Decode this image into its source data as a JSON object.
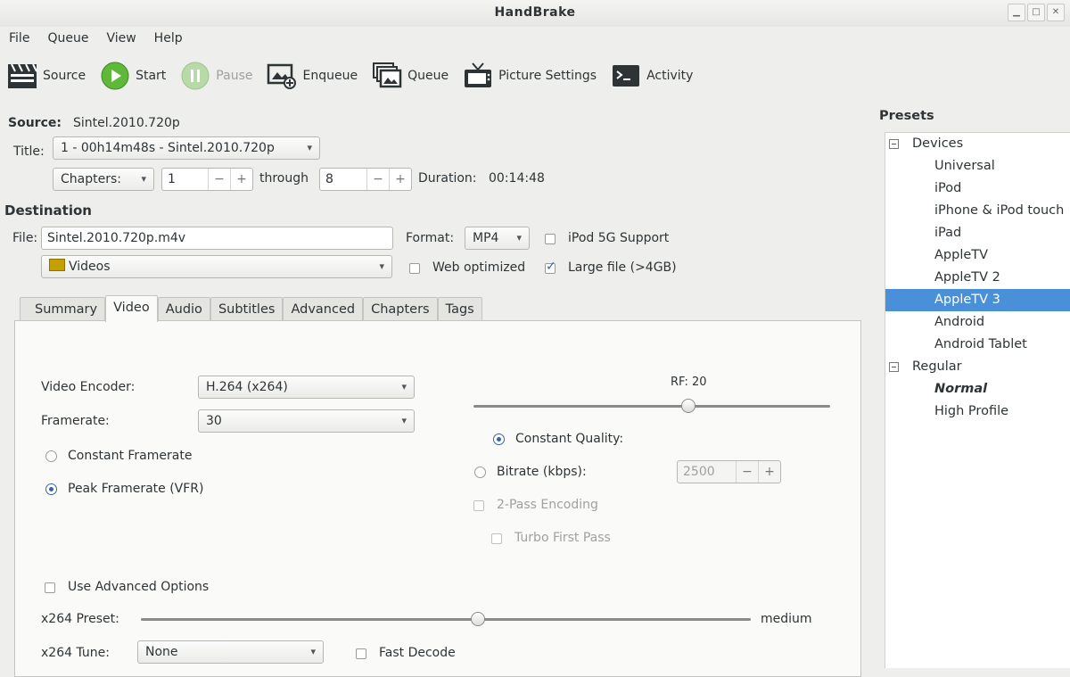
{
  "window": {
    "title": "HandBrake"
  },
  "menu": [
    "File",
    "Queue",
    "View",
    "Help"
  ],
  "toolbar": {
    "source": "Source",
    "start": "Start",
    "pause": "Pause",
    "enqueue": "Enqueue",
    "queue": "Queue",
    "picture_settings": "Picture Settings",
    "activity": "Activity"
  },
  "source": {
    "label": "Source:",
    "value": "Sintel.2010.720p"
  },
  "title_row": {
    "label": "Title:",
    "value": "1 - 00h14m48s - Sintel.2010.720p"
  },
  "chapters": {
    "mode": "Chapters:",
    "start": "1",
    "through_label": "through",
    "end": "8",
    "duration_label": "Duration:",
    "duration": "00:14:48"
  },
  "destination": {
    "heading": "Destination",
    "file_label": "File:",
    "file_value": "Sintel.2010.720p.m4v",
    "folder": "Videos",
    "format_label": "Format:",
    "format_value": "MP4",
    "ipod_5g": "iPod 5G Support",
    "web_optimized": "Web optimized",
    "large_file": "Large file (>4GB)"
  },
  "tabs": [
    "Summary",
    "Video",
    "Audio",
    "Subtitles",
    "Advanced",
    "Chapters",
    "Tags"
  ],
  "video": {
    "encoder_label": "Video Encoder:",
    "encoder_value": "H.264 (x264)",
    "framerate_label": "Framerate:",
    "framerate_value": "30",
    "constant_framerate": "Constant Framerate",
    "peak_framerate": "Peak Framerate (VFR)",
    "rf_label": "RF: 20",
    "rf_value": 20,
    "constant_quality": "Constant Quality:",
    "bitrate_label": "Bitrate (kbps):",
    "bitrate_value": "2500",
    "two_pass": "2-Pass Encoding",
    "turbo_first_pass": "Turbo First Pass",
    "use_advanced": "Use Advanced Options",
    "preset_label": "x264 Preset:",
    "preset_value": "medium",
    "tune_label": "x264 Tune:",
    "tune_value": "None",
    "fast_decode": "Fast Decode"
  },
  "presets": {
    "title": "Presets",
    "devices_group": "Devices",
    "devices": [
      "Universal",
      "iPod",
      "iPhone & iPod touch",
      "iPad",
      "AppleTV",
      "AppleTV 2",
      "AppleTV 3",
      "Android",
      "Android Tablet"
    ],
    "regular_group": "Regular",
    "regular": [
      "Normal",
      "High Profile"
    ],
    "selected": "AppleTV 3"
  },
  "colors": {
    "accent": "#4a90d9",
    "start_green": "#4caf28",
    "radio_blue": "#3465a4"
  }
}
